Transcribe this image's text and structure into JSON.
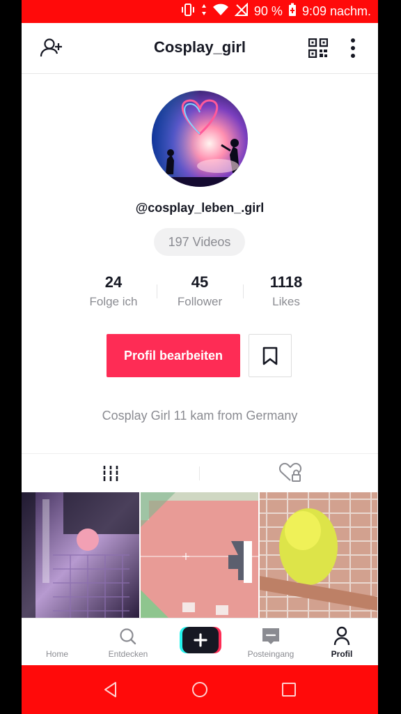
{
  "status_bar": {
    "battery": "90 %",
    "time": "9:09 nachm."
  },
  "header": {
    "title": "Cosplay_girl",
    "icons": [
      "add-user-icon",
      "qr-code-icon",
      "more-vertical-icon"
    ]
  },
  "profile": {
    "username": "@cosplay_leben_.girl",
    "videos_pill": "197 Videos",
    "stats": [
      {
        "number": "24",
        "label": "Folge ich"
      },
      {
        "number": "45",
        "label": "Follower"
      },
      {
        "number": "1118",
        "label": "Likes"
      }
    ],
    "edit_button": "Profil bearbeiten",
    "bio": "Cosplay Girl 11 kam from Germany"
  },
  "tabs": {
    "items": [
      "videos-grid-icon",
      "liked-locked-icon"
    ],
    "active": 0
  },
  "bottom_nav": {
    "items": [
      {
        "label": "Home",
        "icon": "home-icon"
      },
      {
        "label": "Entdecken",
        "icon": "search-icon"
      },
      {
        "label": "",
        "icon": "plus-icon"
      },
      {
        "label": "Posteingang",
        "icon": "inbox-icon"
      },
      {
        "label": "Profil",
        "icon": "profile-icon"
      }
    ],
    "active": "Profil"
  },
  "system_nav": {
    "icons": [
      "back-icon",
      "home-circle-icon",
      "recents-icon"
    ]
  },
  "colors": {
    "accent": "#fe2c55",
    "status_bar": "#ff0a0a",
    "text_primary": "#161823",
    "text_secondary": "#8a8b91"
  }
}
